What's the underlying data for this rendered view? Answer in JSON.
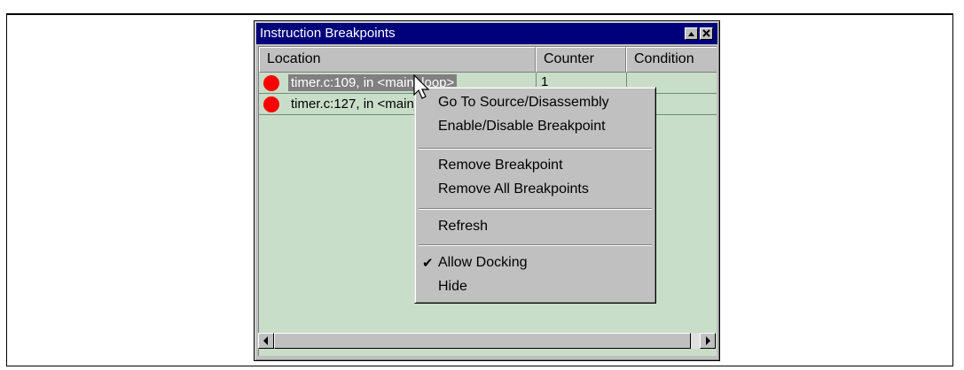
{
  "window": {
    "title": "Instruction Breakpoints",
    "columns": [
      "Location",
      "Counter",
      "Condition"
    ],
    "rows": [
      {
        "location": "timer.c:109, in <main_loop>",
        "counter": "1",
        "condition": "",
        "selected": true
      },
      {
        "location": "timer.c:127, in <main_loop>",
        "counter": "",
        "condition": "",
        "selected": false
      }
    ]
  },
  "context_menu": {
    "items": [
      {
        "label": "Go To Source/Disassembly",
        "checked": false
      },
      {
        "label": "Enable/Disable Breakpoint",
        "checked": false
      },
      {
        "label": "Remove Breakpoint",
        "checked": false
      },
      {
        "label": "Remove All Breakpoints",
        "checked": false
      },
      {
        "label": "Refresh",
        "checked": false
      },
      {
        "label": "Allow Docking",
        "checked": true
      },
      {
        "label": "Hide",
        "checked": false
      }
    ]
  },
  "colors": {
    "titlebar": "#00007b",
    "list_background": "#c8dec8",
    "breakpoint": "#ff0000",
    "selection": "#808080"
  }
}
